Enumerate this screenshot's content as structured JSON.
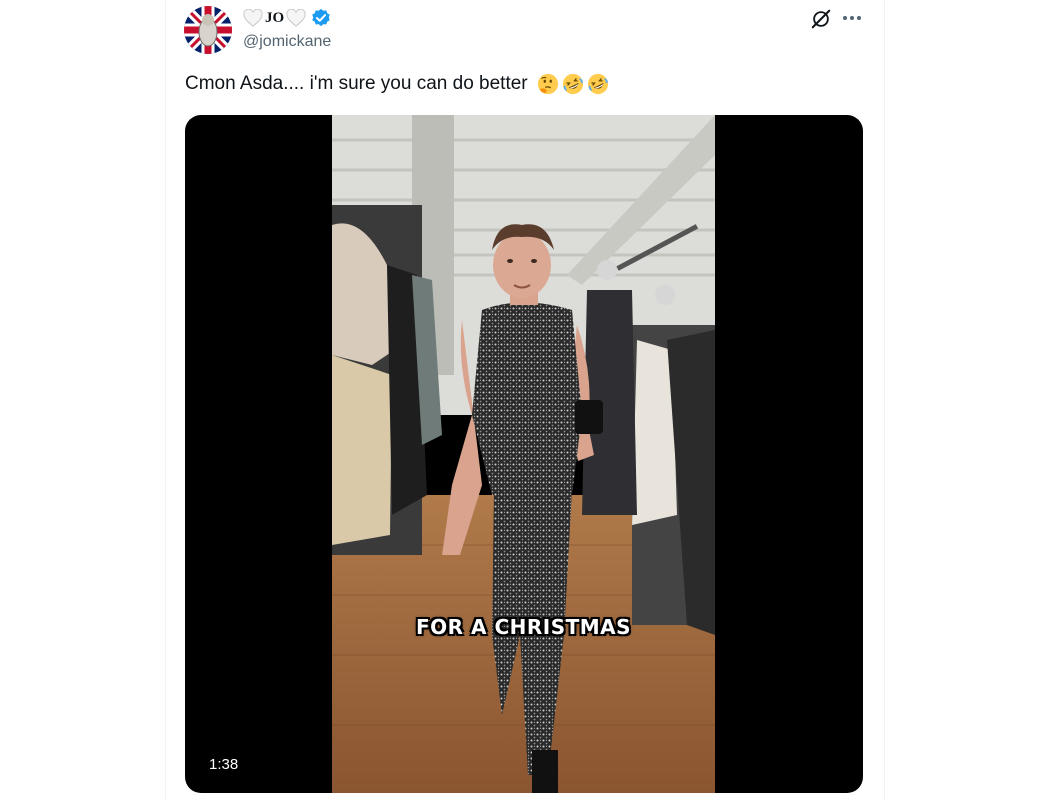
{
  "tweet": {
    "display_name": "JO",
    "handle": "@jomickane",
    "verified": true,
    "text": "Cmon Asda.... i'm sure you can do better",
    "emojis": [
      "thinking-face",
      "rolling-on-floor-laughing",
      "rolling-on-floor-laughing"
    ]
  },
  "media": {
    "type": "video",
    "caption_overlay": "FOR A CHRISTMAS",
    "duration": "1:38"
  },
  "icons": {
    "grok": "grok-icon",
    "more": "more-icon",
    "verified": "verified-badge-icon"
  },
  "colors": {
    "text": "#0f1419",
    "secondary": "#536471",
    "verified_blue": "#1d9bf0"
  }
}
